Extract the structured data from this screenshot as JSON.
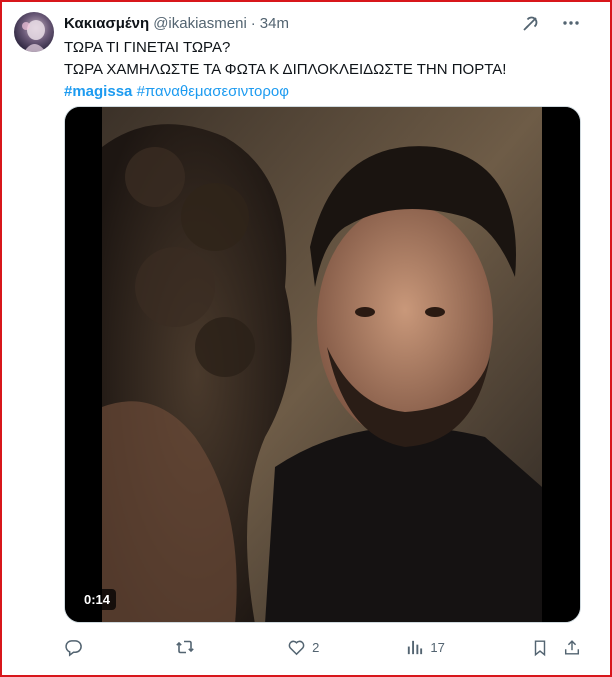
{
  "tweet": {
    "display_name": "Κακιασμένη",
    "handle": "@ikakiasmeni",
    "separator": "·",
    "time": "34m",
    "line1": "ΤΩΡΑ ΤΙ ΓΙΝΕΤΑΙ ΤΩΡΑ?",
    "line2": "ΤΩΡΑ ΧΑΜΗΛΩΣΤΕ ΤΑ ΦΩΤΑ Κ ΔΙΠΛΟΚΛΕΙΔΩΣΤΕ ΤΗΝ ΠΟΡΤΑ!",
    "hashtag1": "#magissa",
    "hashtag2": "#παναθεμασεσιντοροφ"
  },
  "media": {
    "duration": "0:14"
  },
  "actions": {
    "reply_count": "",
    "retweet_count": "",
    "like_count": "2",
    "views_count": "17"
  },
  "icons": [
    "grok-icon",
    "more-icon",
    "reply-icon",
    "retweet-icon",
    "like-icon",
    "views-icon",
    "bookmark-icon",
    "share-icon"
  ],
  "colors": {
    "text": "#0f1419",
    "muted": "#536471",
    "link": "#1d9bf0",
    "frame": "#d8161b"
  }
}
